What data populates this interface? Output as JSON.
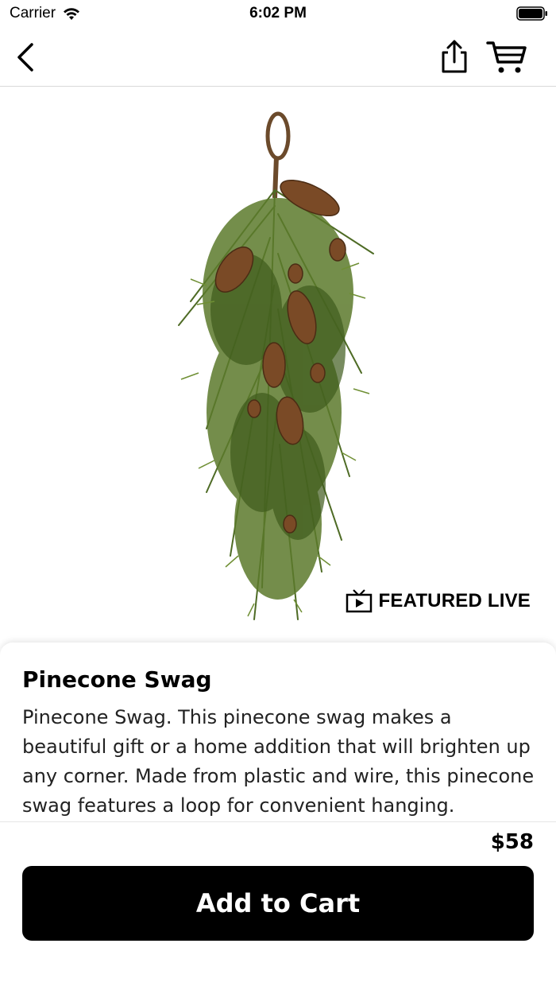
{
  "status_bar": {
    "carrier": "Carrier",
    "time": "6:02 PM",
    "icons": [
      "wifi-icon",
      "battery-icon"
    ]
  },
  "nav": {
    "icons": [
      "back-chevron-icon",
      "share-icon",
      "cart-icon"
    ]
  },
  "product": {
    "image_subject": "pinecone-swag-image",
    "badge_label": "FEATURED LIVE",
    "badge_icon": "live-tv-icon",
    "title": "Pinecone Swag",
    "description": "Pinecone Swag. This pinecone swag makes a beautiful gift or a home addition that will brighten up any corner. Made from plastic and wire, this pinecone swag features a loop for convenient hanging.",
    "price": "$58"
  },
  "actions": {
    "add_to_cart_label": "Add to Cart"
  },
  "colors": {
    "primary_button": "#000000",
    "button_text": "#ffffff",
    "divider": "#d9d9d9"
  }
}
